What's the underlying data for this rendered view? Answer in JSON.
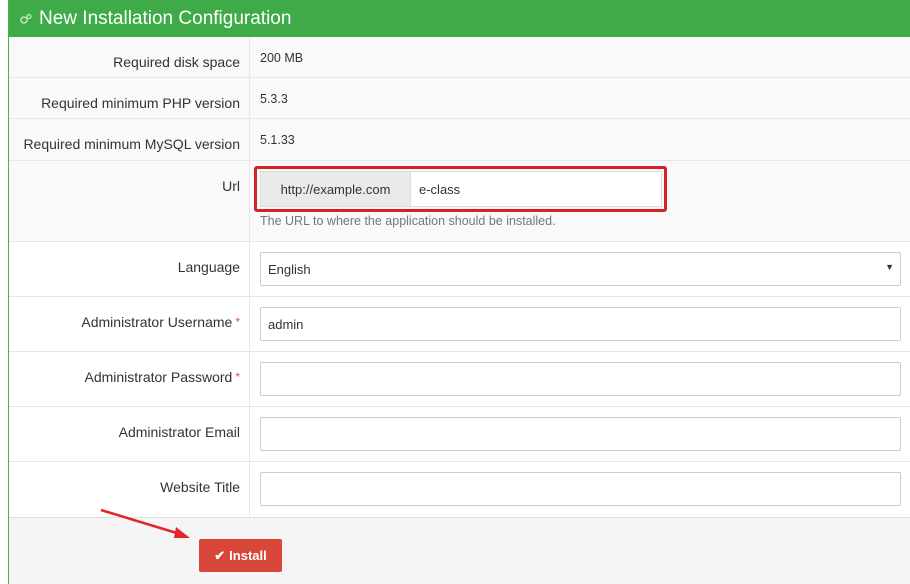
{
  "header": {
    "title": "New Installation Configuration",
    "icon": "gears-icon"
  },
  "requirements": [
    {
      "label": "Required disk space",
      "value": "200 MB"
    },
    {
      "label": "Required minimum PHP version",
      "value": "5.3.3"
    },
    {
      "label": "Required minimum MySQL version",
      "value": "5.1.33"
    }
  ],
  "url": {
    "label": "Url",
    "prefix": "http://example.com",
    "value": "e-class",
    "help": "The URL to where the application should be installed."
  },
  "language": {
    "label": "Language",
    "value": "English"
  },
  "admin_username": {
    "label": "Administrator Username",
    "value": "admin",
    "required_mark": "*"
  },
  "admin_password": {
    "label": "Administrator Password",
    "value": "",
    "required_mark": "*"
  },
  "admin_email": {
    "label": "Administrator Email",
    "value": ""
  },
  "website_title": {
    "label": "Website Title",
    "value": ""
  },
  "install_button": {
    "label": "Install",
    "icon": "check-icon"
  },
  "colors": {
    "header": "#3fab48",
    "install": "#d9473a",
    "highlight": "#d71f26",
    "required": "#d9534f"
  }
}
